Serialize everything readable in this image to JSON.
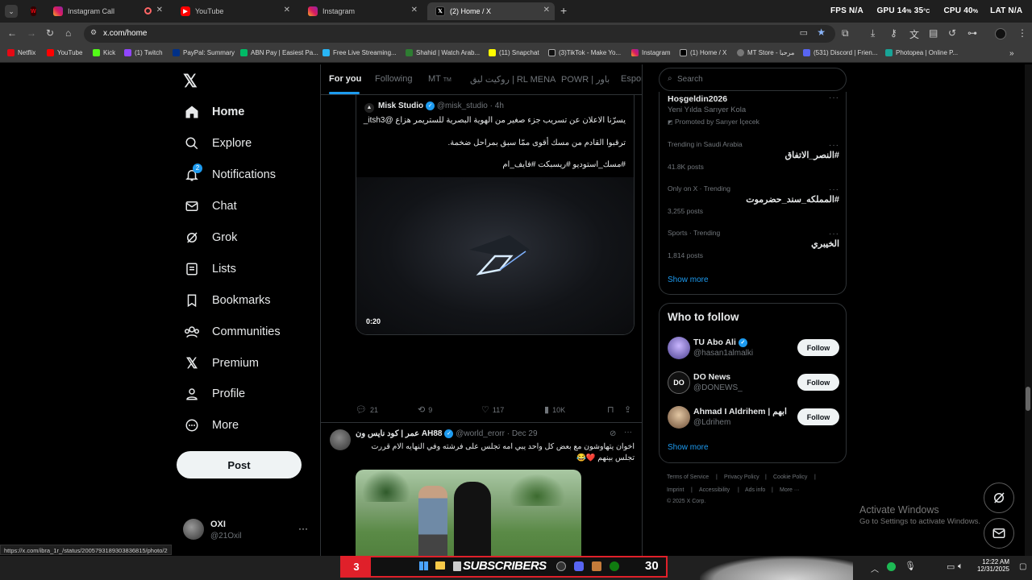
{
  "browser": {
    "tabs": [
      {
        "label": "",
        "favicon": "nf-icon"
      },
      {
        "label": "Instagram Call",
        "favicon": "instagram-icon"
      },
      {
        "label": "YouTube",
        "favicon": "youtube-icon"
      },
      {
        "label": "Instagram",
        "favicon": "instagram-icon"
      },
      {
        "label": "(2) Home / X",
        "favicon": "x-icon"
      }
    ],
    "url": "x.com/home",
    "bookmarks": [
      "Netflix",
      "YouTube",
      "Kick",
      "(1) Twitch",
      "PayPal: Summary",
      "ABN Pay | Easiest Pa...",
      "Free Live Streaming...",
      "Shahid | Watch Arab...",
      "(11) Snapchat",
      "(3)TikTok - Make Yo...",
      "Instagram",
      "(1) Home / X",
      "MT Store - مرحبا",
      "(531) Discord | Frien...",
      "Photopea | Online P..."
    ],
    "hud": {
      "fps_label": "FPS",
      "fps_value": "N/A",
      "gpu_label": "GPU",
      "gpu_value": "14",
      "gpu_temp": "35",
      "cpu_label": "CPU",
      "cpu_value": "40",
      "lat_label": "LAT",
      "lat_value": "N/A"
    }
  },
  "nav": {
    "items": [
      "Home",
      "Explore",
      "Notifications",
      "Chat",
      "Grok",
      "Lists",
      "Bookmarks",
      "Communities",
      "Premium",
      "Profile",
      "More"
    ],
    "notifications_badge": "2",
    "post_label": "Post",
    "account_name": "OXI",
    "account_handle": "@21Oxil"
  },
  "feed": {
    "tabs": [
      "For you",
      "Following",
      "MT",
      "روكيت ليق | RL MENA",
      "POWR | باور",
      "Espor"
    ],
    "quote": {
      "name": "Misk Studio",
      "handle": "@misk_studio",
      "time": "4h",
      "line1": "يسرّنا الاعلان عن تسريب جزء صغير من الهوية البصرية للستريمر هزاع @itsh3_",
      "line2": "ترقبوا القادم من مسك أقوى ممّا سبق بمراحل ضخمة.",
      "line3": "#مسك_استوديو #ريسبكت #فايف_ام",
      "video_time": "0:20"
    },
    "actions": {
      "replies": "21",
      "reposts": "9",
      "likes": "117",
      "views": "10K"
    },
    "post2": {
      "name": "عمر | كود نايس ون AH88",
      "handle": "@world_erorr",
      "time": "Dec 29",
      "line1": "اخوان يتهاوشون مع بعض كل واحد يبي امه تجلس على فرشته وفي النهايه الام قررت",
      "line2": "تجلس بينهم ❤️😂"
    }
  },
  "sidebar": {
    "search_placeholder": "Search",
    "promoted": {
      "title": "Hoşgeldin2026",
      "subtitle": "Yeni Yılda Sarıyer Kola",
      "label": "Promoted by Sarıyer İçecek"
    },
    "trends": [
      {
        "context": "Trending in Saudi Arabia",
        "title": "#النصر_الاتفاق",
        "posts": "41.8K posts"
      },
      {
        "context": "Only on X · Trending",
        "title": "#المملكه_سند_حضرموت",
        "posts": "3,255 posts"
      },
      {
        "context": "Sports · Trending",
        "title": "الخيبري",
        "posts": "1,814 posts"
      }
    ],
    "show_more": "Show more",
    "who_to_follow": "Who to follow",
    "suggestions": [
      {
        "name": "TU Abo Ali",
        "handle": "@hasan1almalki",
        "button": "Follow"
      },
      {
        "name": "DO News",
        "handle": "@DONEWS_",
        "button": "Follow"
      },
      {
        "name": "Ahmad I Aldrihem | ابهم",
        "handle": "@Ldrihem",
        "button": "Follow"
      }
    ],
    "show_more_2": "Show more",
    "footer": [
      "Terms of Service",
      "Privacy Policy",
      "Cookie Policy",
      "Imprint",
      "Accessibility",
      "Ads info",
      "More ···",
      "© 2025 X Corp."
    ]
  },
  "system": {
    "activate_title": "Activate Windows",
    "activate_sub": "Go to Settings to activate Windows.",
    "status_url": "https://x.com/ibra_1r_/status/2005793189303836815/photo/2",
    "sub_left": "3",
    "sub_label": "SUBSCRIBERS",
    "sub_right": "30",
    "time": "12:22 AM",
    "date": "12/31/2025"
  },
  "colors": {
    "accent": "#1d9bf0",
    "border": "#2f3336",
    "muted": "#71767b",
    "text": "#e7e9ea"
  }
}
